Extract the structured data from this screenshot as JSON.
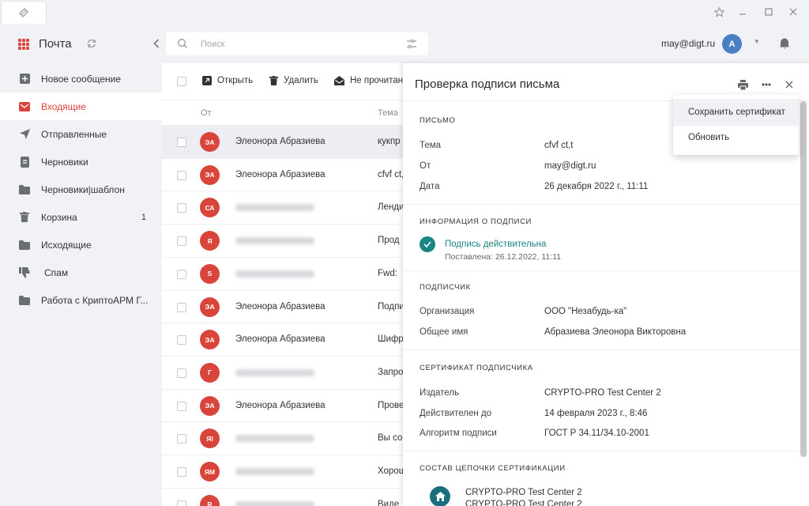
{
  "header": {
    "app_title": "Почта",
    "search_placeholder": "Поиск",
    "user_email": "may@digt.ru",
    "avatar_initial": "A"
  },
  "colors": {
    "accent_red": "#d9453b",
    "valid_green": "#1a8582",
    "avatar_blue": "#4a7fc6"
  },
  "sidebar": {
    "items": [
      {
        "label": "Новое сообщение",
        "icon": "plus-square-icon"
      },
      {
        "label": "Входящие",
        "icon": "envelope-icon",
        "active": true
      },
      {
        "label": "Отправленные",
        "icon": "send-icon"
      },
      {
        "label": "Черновики",
        "icon": "draft-icon"
      },
      {
        "label": "Черновики|шаблон",
        "icon": "folder-icon"
      },
      {
        "label": "Корзина",
        "icon": "trash-icon",
        "count": "1"
      },
      {
        "label": "Исходящие",
        "icon": "folder-icon"
      },
      {
        "label": "Спам",
        "icon": "thumbs-down-icon"
      },
      {
        "label": "Работа с КриптоАРМ Г...",
        "icon": "folder-icon"
      }
    ]
  },
  "toolbar": {
    "open_label": "Открыть",
    "delete_label": "Удалить",
    "unread_label": "Не прочитано"
  },
  "list": {
    "col_from": "От",
    "col_subject": "Тема",
    "rows": [
      {
        "initials": "ЭА",
        "sender": "Элеонора Абразиева",
        "subject": "кукпр",
        "selected": true
      },
      {
        "initials": "ЭА",
        "sender": "Элеонора Абразиева",
        "subject": "cfvf ct,t"
      },
      {
        "initials": "СА",
        "sender": "",
        "subject": "Ленди"
      },
      {
        "initials": "Я",
        "sender": "",
        "subject": "Прод"
      },
      {
        "initials": "S",
        "sender": "",
        "subject": "Fwd:"
      },
      {
        "initials": "ЭА",
        "sender": "Элеонора Абразиева",
        "subject": "Подпи"
      },
      {
        "initials": "ЭА",
        "sender": "Элеонора Абразиева",
        "subject": "Шифр"
      },
      {
        "initials": "Г",
        "sender": "",
        "subject": "Запро"
      },
      {
        "initials": "ЭА",
        "sender": "Элеонора Абразиева",
        "subject": "Прове"
      },
      {
        "initials": "ЯI",
        "sender": "",
        "subject": "Вы со"
      },
      {
        "initials": "ЯМ",
        "sender": "",
        "subject": "Хорош"
      },
      {
        "initials": "R",
        "sender": "",
        "subject": "Виде"
      }
    ]
  },
  "panel": {
    "title": "Проверка подписи письма",
    "letter": {
      "section": "ПИСЬМО",
      "subject_label": "Тема",
      "subject_value": "cfvf ct,t",
      "from_label": "От",
      "from_value": "may@digt.ru",
      "date_label": "Дата",
      "date_value": "26 декабря 2022 г., 11:11"
    },
    "signature": {
      "section": "ИНФОРМАЦИЯ О ПОДПИСИ",
      "status": "Подпись действительна",
      "placed": "Поставлена: 26.12.2022, 11:11"
    },
    "signer": {
      "section": "ПОДПИСЧИК",
      "org_label": "Организация",
      "org_value": "ООО \"Незабудь-ка\"",
      "name_label": "Общее имя",
      "name_value": "Абразиева Элеонора Викторовна"
    },
    "certificate": {
      "section": "СЕРТИФИКАТ ПОДПИСЧИКА",
      "issuer_label": "Издатель",
      "issuer_value": "CRYPTO-PRO Test Center 2",
      "valid_label": "Действителен до",
      "valid_value": "14 февраля 2023 г., 8:46",
      "algo_label": "Алгоритм подписи",
      "algo_value": "ГОСТ Р 34.11/34.10-2001"
    },
    "chain": {
      "section": "СОСТАВ ЦЕПОЧКИ СЕРТИФИКАЦИИ",
      "items": [
        "CRYPTO-PRO Test Center 2",
        "CRYPTO-PRO Test Center 2"
      ]
    }
  },
  "menu": {
    "save_cert": "Сохранить сертификат",
    "refresh": "Обновить"
  }
}
